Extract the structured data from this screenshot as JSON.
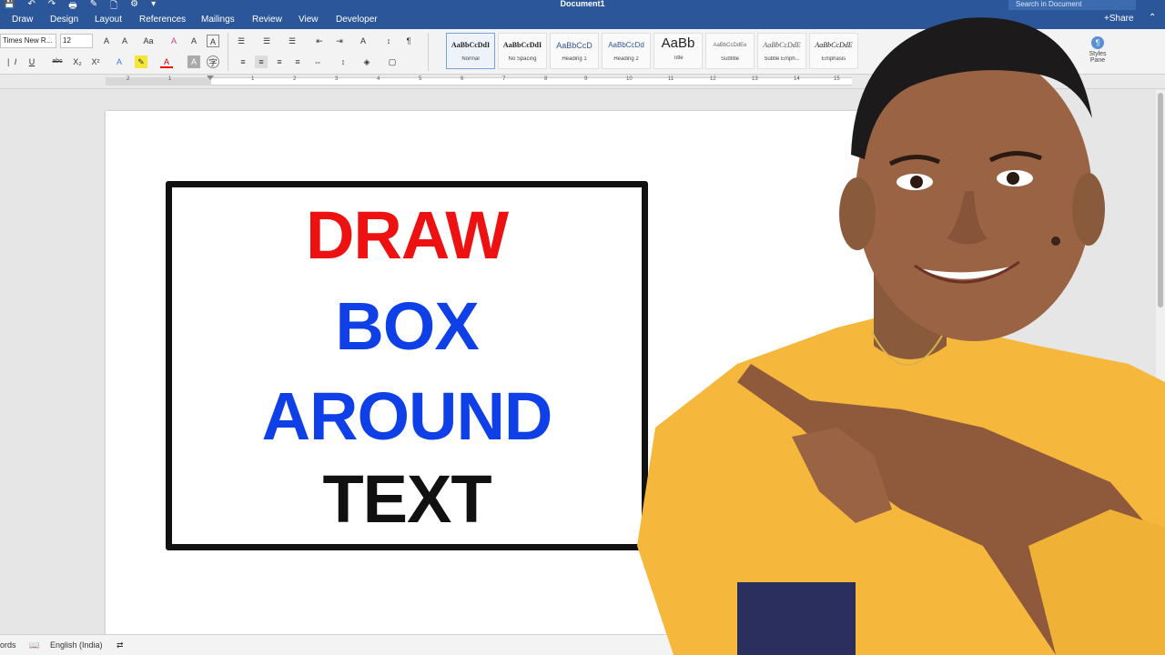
{
  "titlebar": {
    "quick_access": [
      "💾",
      "↶",
      "↷",
      "🖶",
      "✎",
      "🗋",
      "⚙",
      "▾"
    ],
    "document_title": "Document1",
    "search_placeholder": "Search in Document"
  },
  "tabs": [
    "Draw",
    "Design",
    "Layout",
    "References",
    "Mailings",
    "Review",
    "View",
    "Developer"
  ],
  "share_label": "Share",
  "ribbon": {
    "font_name": "Times New R...",
    "font_size": "12",
    "styles": [
      {
        "sample": "AaBbCcDdI",
        "name": "Normal"
      },
      {
        "sample": "AaBbCcDdI",
        "name": "No Spacing"
      },
      {
        "sample": "AaBbCcD",
        "name": "Heading 1"
      },
      {
        "sample": "AaBbCcDd",
        "name": "Heading 2"
      },
      {
        "sample": "AaBb",
        "name": "Title"
      },
      {
        "sample": "AaBbCcDdEe",
        "name": "Subtitle"
      },
      {
        "sample": "AaBbCcDdE",
        "name": "Subtle Emph..."
      },
      {
        "sample": "AaBbCcDdE",
        "name": "Emphasis"
      }
    ],
    "styles_pane_label": "Styles Pane"
  },
  "ruler": {
    "numbers": [
      "2",
      "1",
      "1",
      "2",
      "3",
      "4",
      "5",
      "6",
      "7",
      "8",
      "9",
      "10",
      "11",
      "12",
      "13",
      "14",
      "15",
      "16"
    ]
  },
  "document": {
    "lines": [
      {
        "text": "DRAW",
        "color": "#ee1111"
      },
      {
        "text": "BOX",
        "color": "#0f3fe6"
      },
      {
        "text": "AROUND",
        "color": "#0f3fe6"
      },
      {
        "text": "TEXT",
        "color": "#111111"
      }
    ]
  },
  "statusbar": {
    "words": "ords",
    "language": "English (India)"
  },
  "colors": {
    "accent": "#2b579a",
    "box_border": "#111111",
    "shirt": "#f5b83c"
  }
}
